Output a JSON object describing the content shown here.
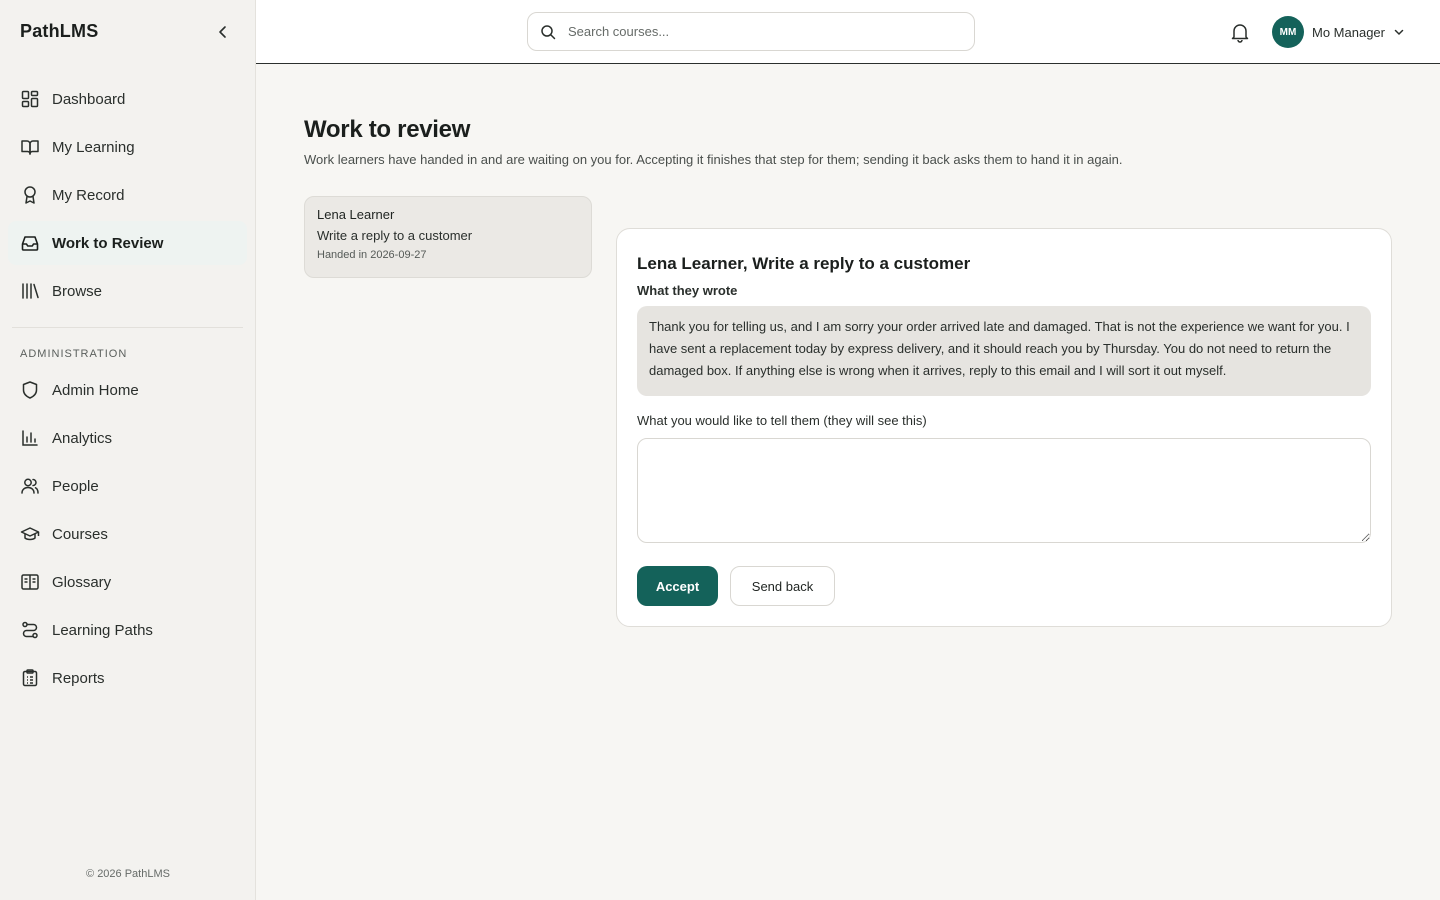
{
  "app": {
    "brand": "PathLMS",
    "footer": "© 2026 PathLMS"
  },
  "sidebar": {
    "items": [
      {
        "label": "Dashboard",
        "icon": "dashboard-icon"
      },
      {
        "label": "My Learning",
        "icon": "book-open-icon"
      },
      {
        "label": "My Record",
        "icon": "award-icon"
      },
      {
        "label": "Work to Review",
        "icon": "inbox-icon",
        "active": true
      },
      {
        "label": "Browse",
        "icon": "library-icon"
      }
    ],
    "admin_title": "ADMINISTRATION",
    "admin_items": [
      {
        "label": "Admin Home",
        "icon": "shield-icon"
      },
      {
        "label": "Analytics",
        "icon": "bar-chart-icon"
      },
      {
        "label": "People",
        "icon": "users-icon"
      },
      {
        "label": "Courses",
        "icon": "graduation-cap-icon"
      },
      {
        "label": "Glossary",
        "icon": "book-text-icon"
      },
      {
        "label": "Learning Paths",
        "icon": "route-icon"
      },
      {
        "label": "Reports",
        "icon": "clipboard-icon"
      }
    ]
  },
  "topbar": {
    "search_placeholder": "Search courses...",
    "user": {
      "initials": "MM",
      "name": "Mo Manager"
    }
  },
  "page": {
    "title": "Work to review",
    "subtitle": "Work learners have handed in and are waiting on you for. Accepting it finishes that step for them; sending it back asks them to hand it in again."
  },
  "queue": [
    {
      "learner": "Lena Learner",
      "task": "Write a reply to a customer",
      "handed_in": "Handed in 2026-09-27"
    }
  ],
  "review": {
    "title": "Lena Learner, Write a reply to a customer",
    "wrote_label": "What they wrote",
    "answer": "Thank you for telling us, and I am sorry your order arrived late and damaged. That is not the experience we want for you. I have sent a replacement today by express delivery, and it should reach you by Thursday. You do not need to return the damaged box. If anything else is wrong when it arrives, reply to this email and I will sort it out myself.",
    "feedback_label": "What you would like to tell them (they will see this)",
    "feedback_value": "",
    "accept_label": "Accept",
    "send_back_label": "Send back"
  },
  "colors": {
    "accent": "#14625a",
    "active_nav_bg": "#eef3f1"
  }
}
